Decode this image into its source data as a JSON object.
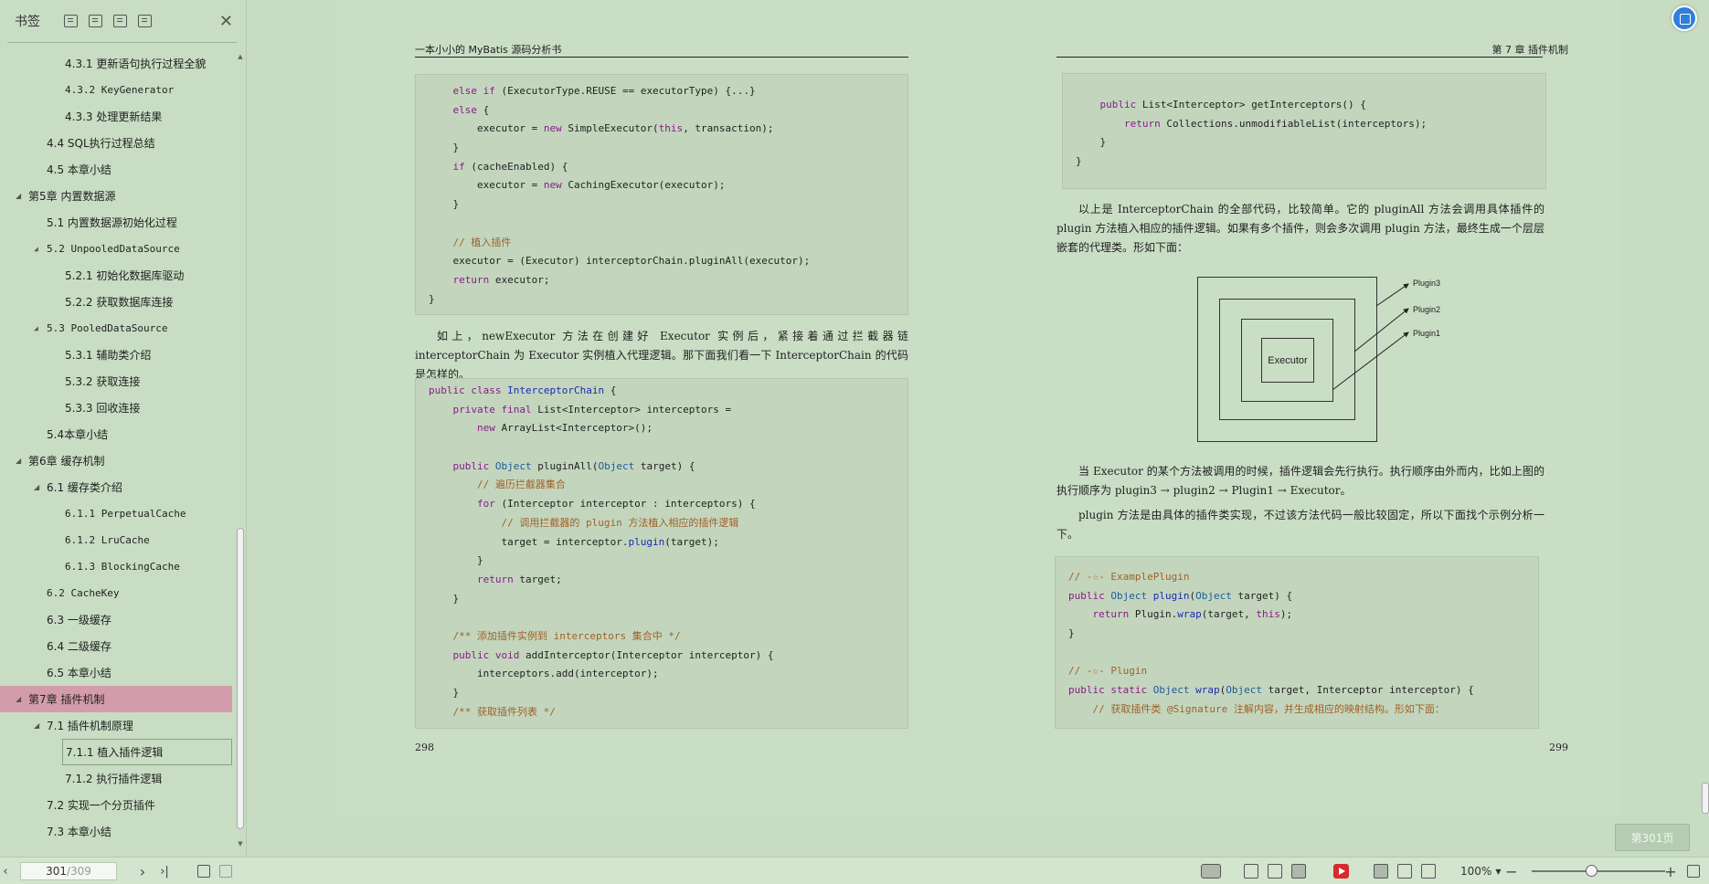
{
  "sidebar": {
    "title": "书签",
    "close_glyph": "✕",
    "toc": [
      {
        "label": "4.3.1 更新语句执行过程全貌",
        "level": 3,
        "tri": ""
      },
      {
        "label": "4.3.2 KeyGenerator",
        "level": 3,
        "tri": "",
        "mono": true
      },
      {
        "label": "4.3.3 处理更新结果",
        "level": 3,
        "tri": ""
      },
      {
        "label": "4.4 SQL执行过程总结",
        "level": 2,
        "tri": ""
      },
      {
        "label": "4.5 本章小结",
        "level": 2,
        "tri": ""
      },
      {
        "label": "第5章 内置数据源",
        "level": 1,
        "tri": "◢"
      },
      {
        "label": "5.1 内置数据源初始化过程",
        "level": 2,
        "tri": ""
      },
      {
        "label": "5.2 UnpooledDataSource",
        "level": 2,
        "tri": "◢",
        "mono": true
      },
      {
        "label": "5.2.1 初始化数据库驱动",
        "level": 3,
        "tri": ""
      },
      {
        "label": "5.2.2 获取数据库连接",
        "level": 3,
        "tri": ""
      },
      {
        "label": "5.3 PooledDataSource",
        "level": 2,
        "tri": "◢",
        "mono": true
      },
      {
        "label": "5.3.1 辅助类介绍",
        "level": 3,
        "tri": ""
      },
      {
        "label": "5.3.2 获取连接",
        "level": 3,
        "tri": ""
      },
      {
        "label": "5.3.3 回收连接",
        "level": 3,
        "tri": ""
      },
      {
        "label": "5.4本章小结",
        "level": 2,
        "tri": ""
      },
      {
        "label": "第6章 缓存机制",
        "level": 1,
        "tri": "◢"
      },
      {
        "label": "6.1 缓存类介绍",
        "level": 2,
        "tri": "◢"
      },
      {
        "label": "6.1.1 PerpetualCache",
        "level": 3,
        "tri": "",
        "mono": true
      },
      {
        "label": "6.1.2 LruCache",
        "level": 3,
        "tri": "",
        "mono": true
      },
      {
        "label": "6.1.3 BlockingCache",
        "level": 3,
        "tri": "",
        "mono": true
      },
      {
        "label": "6.2 CacheKey",
        "level": 2,
        "tri": "",
        "mono": true
      },
      {
        "label": "6.3 一级缓存",
        "level": 2,
        "tri": ""
      },
      {
        "label": "6.4 二级缓存",
        "level": 2,
        "tri": ""
      },
      {
        "label": "6.5 本章小结",
        "level": 2,
        "tri": ""
      },
      {
        "label": "第7章 插件机制",
        "level": 1,
        "tri": "◢",
        "active": true
      },
      {
        "label": "7.1 插件机制原理",
        "level": 2,
        "tri": "◢"
      },
      {
        "label": "7.1.1 植入插件逻辑",
        "level": 3,
        "tri": "",
        "selected": true
      },
      {
        "label": "7.1.2 执行插件逻辑",
        "level": 3,
        "tri": ""
      },
      {
        "label": "7.2 实现一个分页插件",
        "level": 2,
        "tri": ""
      },
      {
        "label": "7.3 本章小结",
        "level": 2,
        "tri": ""
      }
    ]
  },
  "left_page": {
    "running_head": "一本小小的 MyBatis 源码分析书",
    "page_number": "298",
    "code1": [
      "    else if (ExecutorType.REUSE == executorType) {...}",
      "    else {",
      "        executor = new SimpleExecutor(this, transaction);",
      "    }",
      "    if (cacheEnabled) {",
      "        executor = new CachingExecutor(executor);",
      "    }",
      "",
      "    // 植入插件",
      "    executor = (Executor) interceptorChain.pluginAll(executor);",
      "    return executor;",
      "}"
    ],
    "paragraph": "如上，newExecutor 方法在创建好 Executor 实例后，紧接着通过拦截器链 interceptorChain 为 Executor 实例植入代理逻辑。那下面我们看一下 InterceptorChain 的代码是怎样的。",
    "code2": [
      "public class InterceptorChain {",
      "    private final List<Interceptor> interceptors =",
      "        new ArrayList<Interceptor>();",
      "",
      "    public Object pluginAll(Object target) {",
      "        // 遍历拦截器集合",
      "        for (Interceptor interceptor : interceptors) {",
      "            // 调用拦截器的 plugin 方法植入相应的插件逻辑",
      "            target = interceptor.plugin(target);",
      "        }",
      "        return target;",
      "    }",
      "",
      "    /** 添加插件实例到 interceptors 集合中 */",
      "    public void addInterceptor(Interceptor interceptor) {",
      "        interceptors.add(interceptor);",
      "    }",
      "    /** 获取插件列表 */"
    ]
  },
  "right_page": {
    "running_head": "第 7 章  插件机制",
    "page_number": "299",
    "code1": [
      "    public List<Interceptor> getInterceptors() {",
      "        return Collections.unmodifiableList(interceptors);",
      "    }",
      "}"
    ],
    "paragraph1": "以上是 InterceptorChain 的全部代码，比较简单。它的 pluginAll 方法会调用具体插件的 plugin 方法植入相应的插件逻辑。如果有多个插件，则会多次调用 plugin 方法，最终生成一个层层嵌套的代理类。形如下面：",
    "diagram": {
      "center": "Executor",
      "labels": [
        "Plugin3",
        "Plugin2",
        "Plugin1"
      ]
    },
    "paragraph2": "当 Executor 的某个方法被调用的时候，插件逻辑会先行执行。执行顺序由外而内，比如上图的执行顺序为 plugin3 → plugin2 → Plugin1 → Executor。",
    "paragraph3": "plugin 方法是由具体的插件类实现，不过该方法代码一般比较固定，所以下面找个示例分析一下。",
    "code2": [
      "// -☆- ExamplePlugin",
      "public Object plugin(Object target) {",
      "    return Plugin.wrap(target, this);",
      "}",
      "",
      "// -☆- Plugin",
      "public static Object wrap(Object target, Interceptor interceptor) {",
      "    // 获取插件类 @Signature 注解内容，并生成相应的映射结构。形如下面："
    ]
  },
  "goto_page": "第301页",
  "statusbar": {
    "current_page": "301",
    "total_pages": "/309",
    "zoom": "100%",
    "zoom_level_percent": 100,
    "prev_glyph": "‹",
    "next_glyph": "›",
    "last_glyph": "›|",
    "minus_glyph": "−",
    "plus_glyph": "+"
  },
  "colors": {
    "background": "#c7dcc2",
    "active_toc": "#d49cab",
    "play_red": "#d62b2b",
    "float_blue": "#2f7fdc"
  }
}
